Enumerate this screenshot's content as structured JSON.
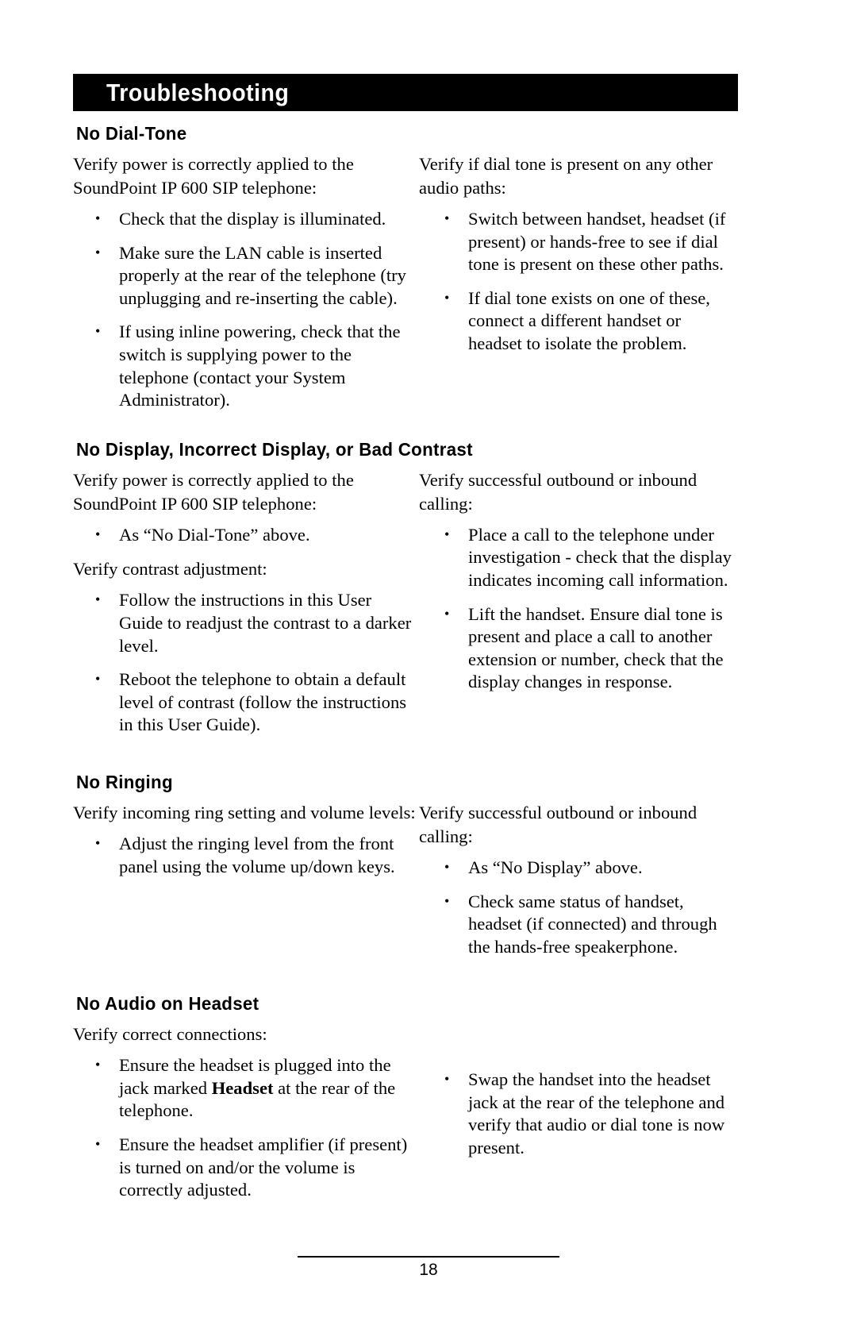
{
  "banner": {
    "title": "Troubleshooting"
  },
  "sections": [
    {
      "heading": "No Dial-Tone",
      "left": {
        "lead": "Verify power is correctly applied to the SoundPoint IP 600 SIP telephone:",
        "bullets": [
          "Check that the display is illuminated.",
          "Make sure the LAN cable is inserted properly at the rear of the telephone (try unplugging and re-inserting the cable).",
          "If using inline powering, check that the switch is supplying power to the telephone (contact your System Administrator)."
        ]
      },
      "right": {
        "lead": "Verify if dial tone is present on any other audio paths:",
        "bullets": [
          "Switch between handset, headset (if present) or hands-free to see if dial tone is present on these other paths.",
          "If dial tone exists on one of these, connect a different handset or headset to isolate the problem."
        ]
      }
    },
    {
      "heading": "No Display, Incorrect Display, or Bad Contrast",
      "left": {
        "lead": "Verify power is correctly applied to the SoundPoint IP 600 SIP telephone:",
        "bullets": [
          "As “No Dial-Tone” above."
        ],
        "lead2": "Verify contrast adjustment:",
        "bullets2": [
          "Follow the instructions in this User Guide to readjust the contrast to a darker level.",
          "Reboot the telephone to obtain a default level of contrast (follow the instructions in this User Guide)."
        ]
      },
      "right": {
        "lead": "Verify successful outbound or inbound calling:",
        "bullets": [
          "Place a call to the telephone under investigation - check that the display indicates incoming call information.",
          "Lift the handset.  Ensure dial tone is present and place a call to another extension or number, check that the display changes in response."
        ]
      }
    },
    {
      "heading": "No Ringing",
      "left": {
        "lead": "Verify incoming ring setting and volume levels:",
        "bullets": [
          "Adjust the ringing level from the front panel using the volume up/down keys."
        ]
      },
      "right": {
        "lead": "Verify successful outbound or inbound calling:",
        "bullets": [
          "As “No Display” above.",
          "Check same status of handset, headset (if connected) and through the hands-free speakerphone."
        ]
      }
    },
    {
      "heading": "No Audio on Headset",
      "left": {
        "lead": "Verify correct connections:",
        "bullets_rich": [
          {
            "pre": "Ensure the headset is plugged into the jack marked ",
            "bold": "Headset",
            "post": " at the rear of the telephone."
          },
          {
            "pre": "Ensure the headset amplifier (if present) is turned on and/or the volume is correctly adjusted.",
            "bold": "",
            "post": ""
          }
        ]
      },
      "right": {
        "bullets": [
          "Swap the handset into the headset jack at the rear of the telephone and verify that audio or dial tone is now present."
        ]
      }
    }
  ],
  "footer": {
    "page_number": "18"
  }
}
